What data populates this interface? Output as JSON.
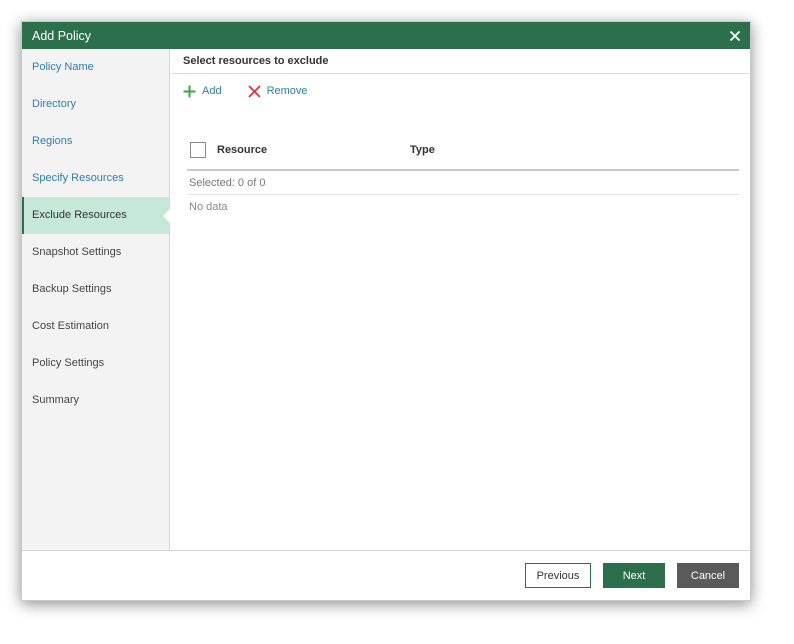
{
  "window": {
    "title": "Add Policy"
  },
  "sidebar": {
    "items": [
      {
        "label": "Policy Name"
      },
      {
        "label": "Directory"
      },
      {
        "label": "Regions"
      },
      {
        "label": "Specify Resources"
      },
      {
        "label": "Exclude Resources"
      },
      {
        "label": "Snapshot Settings"
      },
      {
        "label": "Backup Settings"
      },
      {
        "label": "Cost Estimation"
      },
      {
        "label": "Policy Settings"
      },
      {
        "label": "Summary"
      }
    ],
    "active_index": 4
  },
  "main": {
    "header": "Select resources to exclude",
    "toolbar": {
      "add_label": "Add",
      "remove_label": "Remove"
    },
    "table": {
      "columns": [
        "Resource",
        "Type"
      ],
      "selected_text": "Selected:  0 of 0",
      "empty_text": "No data"
    }
  },
  "footer": {
    "previous_label": "Previous",
    "next_label": "Next",
    "cancel_label": "Cancel"
  },
  "colors": {
    "titlebar": "#2b6f4c",
    "active_step": "#c5e8d8",
    "link": "#2f7fae",
    "add_icon": "#3aa842",
    "remove_icon": "#e0353a",
    "cancel_button": "#5a5a5a"
  }
}
